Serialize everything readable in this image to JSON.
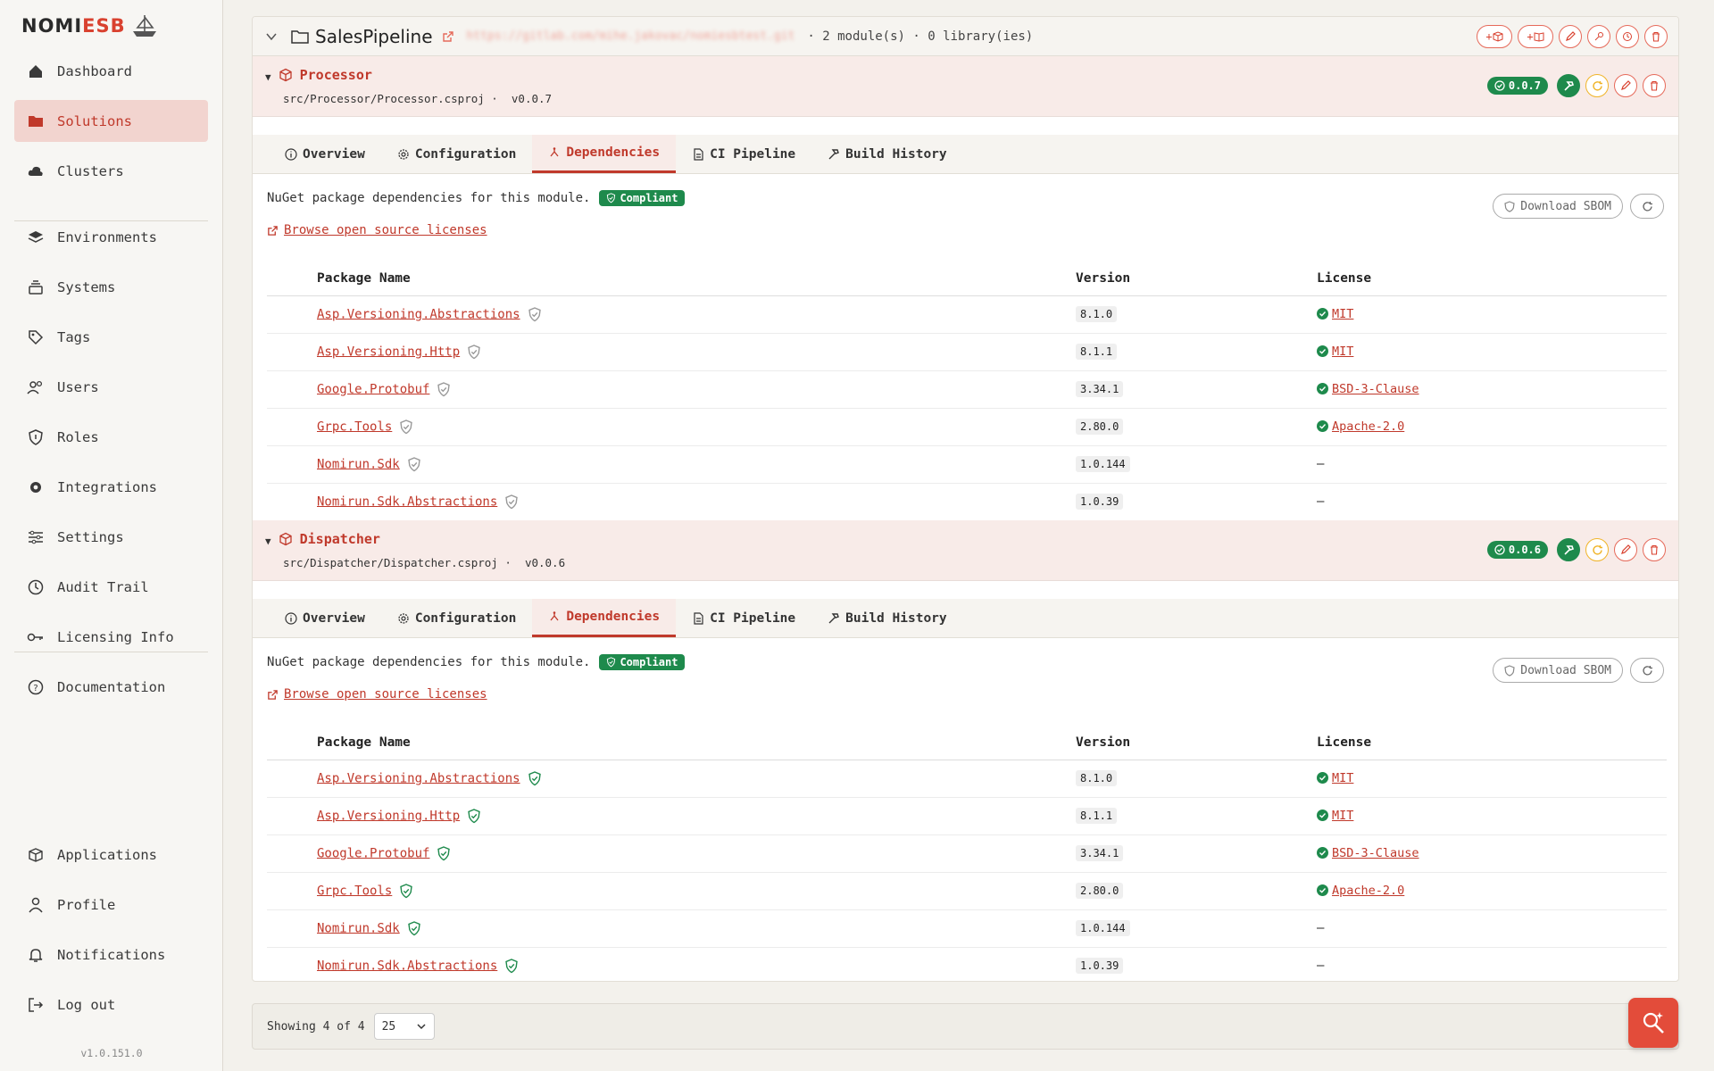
{
  "brand": {
    "logo_main": "NOMI",
    "logo_accent": "ESB"
  },
  "sidebar": {
    "items": [
      {
        "label": "Dashboard",
        "icon": "home-icon"
      },
      {
        "label": "Solutions",
        "icon": "folder-icon"
      },
      {
        "label": "Clusters",
        "icon": "cloud-icon"
      },
      {
        "label": "Environments",
        "icon": "layers-icon"
      },
      {
        "label": "Systems",
        "icon": "stack-icon"
      },
      {
        "label": "Tags",
        "icon": "tags-icon"
      },
      {
        "label": "Users",
        "icon": "users-icon"
      },
      {
        "label": "Roles",
        "icon": "shield-icon"
      },
      {
        "label": "Integrations",
        "icon": "gear-icon"
      },
      {
        "label": "Settings",
        "icon": "sliders-icon"
      },
      {
        "label": "Audit Trail",
        "icon": "clock-icon"
      },
      {
        "label": "Licensing Info",
        "icon": "key-icon"
      },
      {
        "label": "Documentation",
        "icon": "help-icon"
      }
    ],
    "bottom_items": [
      {
        "label": "Applications",
        "icon": "box-icon"
      },
      {
        "label": "Profile",
        "icon": "person-icon"
      },
      {
        "label": "Notifications",
        "icon": "bell-icon"
      },
      {
        "label": "Log out",
        "icon": "logout-icon"
      }
    ],
    "version": "v1.0.151.0"
  },
  "solution": {
    "name": "SalesPipeline",
    "url": "https://gitlab.com/mihe.jakovac/nomiesbtest.git",
    "meta": "· 2 module(s) · 0 library(ies)"
  },
  "modules": [
    {
      "name": "Processor",
      "path": "src/Processor/Processor.csproj ·",
      "version": "v0.0.7",
      "badge": "0.0.7",
      "tabs": [
        "Overview",
        "Configuration",
        "Dependencies",
        "CI Pipeline",
        "Build History"
      ],
      "description": "NuGet package dependencies for this module.",
      "compliance": "Compliant",
      "browse_label": "Browse open source licenses",
      "sbom_label": "Download SBOM",
      "columns": [
        "Package Name",
        "Version",
        "License"
      ],
      "packages": [
        {
          "name": "Asp.Versioning.Abstractions",
          "version": "8.1.0",
          "license": "MIT"
        },
        {
          "name": "Asp.Versioning.Http",
          "version": "8.1.1",
          "license": "MIT"
        },
        {
          "name": "Google.Protobuf",
          "version": "3.34.1",
          "license": "BSD-3-Clause"
        },
        {
          "name": "Grpc.Tools",
          "version": "2.80.0",
          "license": "Apache-2.0"
        },
        {
          "name": "Nomirun.Sdk",
          "version": "1.0.144",
          "license": "–"
        },
        {
          "name": "Nomirun.Sdk.Abstractions",
          "version": "1.0.39",
          "license": "–"
        }
      ]
    },
    {
      "name": "Dispatcher",
      "path": "src/Dispatcher/Dispatcher.csproj ·",
      "version": "v0.0.6",
      "badge": "0.0.6",
      "tabs": [
        "Overview",
        "Configuration",
        "Dependencies",
        "CI Pipeline",
        "Build History"
      ],
      "description": "NuGet package dependencies for this module.",
      "compliance": "Compliant",
      "browse_label": "Browse open source licenses",
      "sbom_label": "Download SBOM",
      "columns": [
        "Package Name",
        "Version",
        "License"
      ],
      "packages": [
        {
          "name": "Asp.Versioning.Abstractions",
          "version": "8.1.0",
          "license": "MIT"
        },
        {
          "name": "Asp.Versioning.Http",
          "version": "8.1.1",
          "license": "MIT"
        },
        {
          "name": "Google.Protobuf",
          "version": "3.34.1",
          "license": "BSD-3-Clause"
        },
        {
          "name": "Grpc.Tools",
          "version": "2.80.0",
          "license": "Apache-2.0"
        },
        {
          "name": "Nomirun.Sdk",
          "version": "1.0.144",
          "license": "–"
        },
        {
          "name": "Nomirun.Sdk.Abstractions",
          "version": "1.0.39",
          "license": "–"
        }
      ]
    }
  ],
  "pagination": {
    "showing": "Showing 4 of 4",
    "page_size": "25"
  },
  "colors": {
    "accent": "#c0392b",
    "success": "#1e8a4c",
    "warning": "#f0b429"
  }
}
